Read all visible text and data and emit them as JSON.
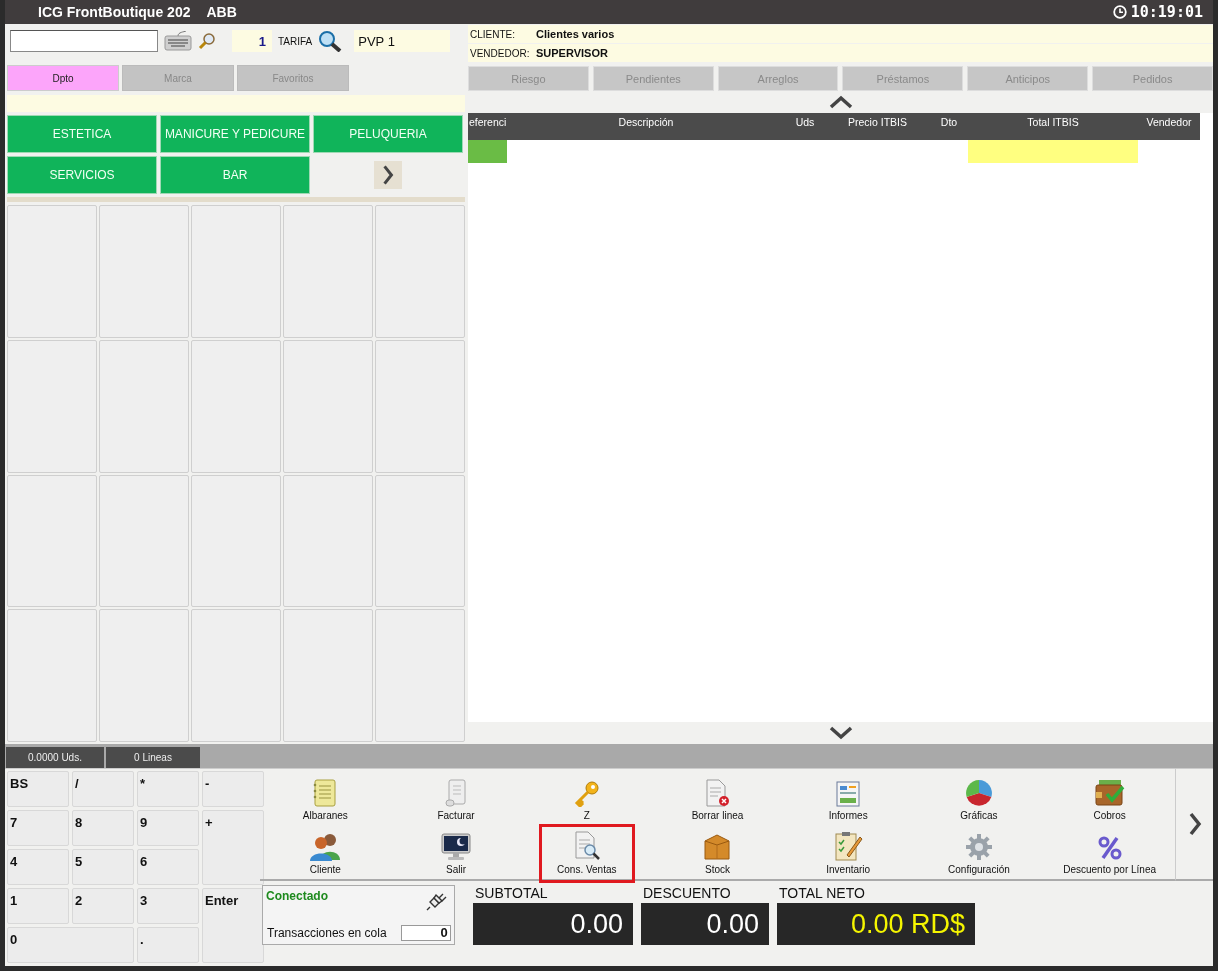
{
  "window": {
    "title": "ICG FrontBoutique 202",
    "user": "ABB",
    "clock": "10:19:01"
  },
  "quantity": "1",
  "tarifa_label": "TARIFA",
  "tarifa": "PVP 1",
  "customer": {
    "cliente_label": "CLIENTE:",
    "cliente": "Clientes varios",
    "vendedor_label": "VENDEDOR:",
    "vendedor": "SUPERVISOR"
  },
  "left_tabs": [
    {
      "label": "Dpto",
      "selected": true
    },
    {
      "label": "Marca",
      "selected": false
    },
    {
      "label": "Favoritos",
      "selected": false
    }
  ],
  "right_tabs": [
    "Riesgo",
    "Pendientes",
    "Arreglos",
    "Préstamos",
    "Anticipos",
    "Pedidos"
  ],
  "categories": [
    "ESTETICA",
    "MANICURE Y PEDICURE",
    "PELUQUERIA",
    "SERVICIOS",
    "BAR"
  ],
  "table": {
    "columns": [
      "eferenci",
      "Descripción",
      "Uds",
      "Precio ITBIS",
      "Dto",
      "Total ITBIS",
      "Vendedor"
    ]
  },
  "summary": {
    "units": "0.0000 Uds.",
    "lines": "0 Lineas"
  },
  "keypad": [
    {
      "label": "BS",
      "kind": "normal"
    },
    {
      "label": "/",
      "kind": "normal"
    },
    {
      "label": "*",
      "kind": "normal"
    },
    {
      "label": "-",
      "kind": "normal"
    },
    {
      "label": "7",
      "kind": "normal"
    },
    {
      "label": "8",
      "kind": "normal"
    },
    {
      "label": "9",
      "kind": "normal"
    },
    {
      "label": "+",
      "kind": "tall"
    },
    {
      "label": "4",
      "kind": "normal"
    },
    {
      "label": "5",
      "kind": "normal"
    },
    {
      "label": "6",
      "kind": "normal"
    },
    {
      "label": "1",
      "kind": "normal"
    },
    {
      "label": "2",
      "kind": "normal"
    },
    {
      "label": "3",
      "kind": "normal"
    },
    {
      "label": "Enter",
      "kind": "tall"
    },
    {
      "label": "0",
      "kind": "wide"
    },
    {
      "label": ".",
      "kind": "normal"
    }
  ],
  "actions": [
    {
      "label": "Albaranes",
      "highlighted": false
    },
    {
      "label": "Facturar",
      "highlighted": false
    },
    {
      "label": "Z",
      "highlighted": false
    },
    {
      "label": "Borrar linea",
      "highlighted": false
    },
    {
      "label": "Informes",
      "highlighted": false
    },
    {
      "label": "Gráficas",
      "highlighted": false
    },
    {
      "label": "Cobros",
      "highlighted": false
    },
    {
      "label": "Cliente",
      "highlighted": false
    },
    {
      "label": "Salir",
      "highlighted": false
    },
    {
      "label": "Cons. Ventas",
      "highlighted": true
    },
    {
      "label": "Stock",
      "highlighted": false
    },
    {
      "label": "Inventario",
      "highlighted": false
    },
    {
      "label": "Configuración",
      "highlighted": false
    },
    {
      "label": "Descuento por Línea",
      "highlighted": false
    }
  ],
  "connection": {
    "status": "Conectado",
    "queue_label": "Transacciones en cola",
    "queue": "0"
  },
  "totals": [
    {
      "label": "SUBTOTAL",
      "value": "0.00",
      "kind": "plain"
    },
    {
      "label": "DESCUENTO",
      "value": "0.00",
      "kind": "plain"
    },
    {
      "label": "TOTAL NETO",
      "value": "0.00 RD$",
      "kind": "grand"
    }
  ]
}
